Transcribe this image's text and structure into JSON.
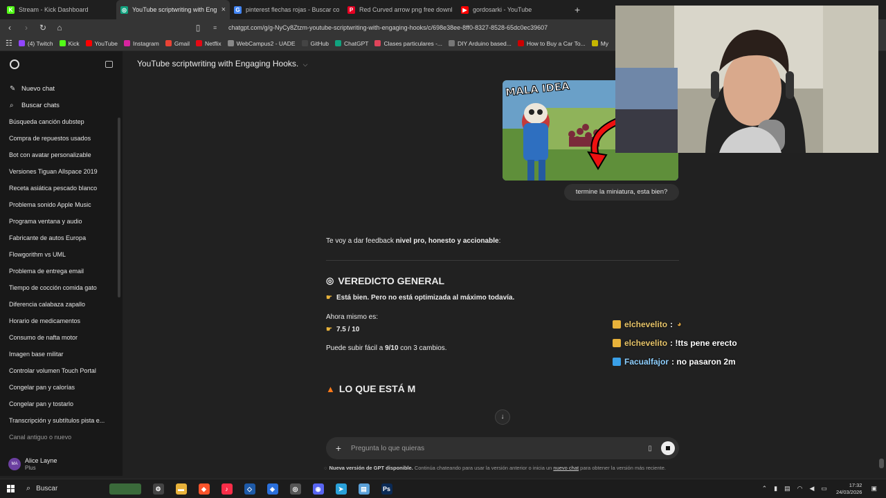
{
  "tabs": [
    {
      "label": "Stream - Kick Dashboard",
      "color": "#53fc18",
      "glyph": "K"
    },
    {
      "label": "YouTube scriptwriting with Eng",
      "color": "#10a37f",
      "glyph": "◎",
      "active": true
    },
    {
      "label": "pinterest flechas rojas - Buscar con G",
      "color": "#4285f4",
      "glyph": "G"
    },
    {
      "label": "Red Curved arrow png free downloa",
      "color": "#e60023",
      "glyph": "P"
    },
    {
      "label": "gordosarki - YouTube",
      "color": "#ff0000",
      "glyph": "▶"
    }
  ],
  "address": {
    "url": "chatgpt.com/g/g-NyCy8Ztzm-youtube-scriptwriting-with-engaging-hooks/c/698e38ee-8ff0-8327-8528-65dc0ec39607"
  },
  "bookmarks": [
    {
      "label": "(4) Twitch",
      "color": "#9146ff"
    },
    {
      "label": "Kick",
      "color": "#53fc18"
    },
    {
      "label": "YouTube",
      "color": "#ff0000"
    },
    {
      "label": "Instagram",
      "color": "#d6249f"
    },
    {
      "label": "Gmail",
      "color": "#ea4335"
    },
    {
      "label": "Netflix",
      "color": "#e50914"
    },
    {
      "label": "WebCampus2 - UADE",
      "color": "#888888"
    },
    {
      "label": "GitHub",
      "color": "#444444"
    },
    {
      "label": "ChatGPT",
      "color": "#10a37f"
    },
    {
      "label": "Clases particulares -...",
      "color": "#e0445a"
    },
    {
      "label": "DIY Arduino based...",
      "color": "#777777"
    },
    {
      "label": "How to Buy a Car To...",
      "color": "#cc0000"
    },
    {
      "label": "My",
      "color": "#c5b600"
    }
  ],
  "sidebar": {
    "new_chat": "Nuevo chat",
    "search_chats": "Buscar chats",
    "items": [
      "Búsqueda canción dubstep",
      "Compra de repuestos usados",
      "Bot con avatar personalizable",
      "Versiones Tiguan Allspace 2019",
      "Receta asiática pescado blanco",
      "Problema sonido Apple Music",
      "Programa ventana y audio",
      "Fabricante de autos Europa",
      "Flowgorithm vs UML",
      "Problema de entrega email",
      "Tiempo de cocción comida gato",
      "Diferencia calabaza zapallo",
      "Horario de medicamentos",
      "Consumo de nafta motor",
      "Imagen base militar",
      "Controlar volumen Touch Portal",
      "Congelar pan y calorías",
      "Congelar pan y tostarlo",
      "Transcripción y subtítulos pista e...",
      "Canal antiguo o nuevo"
    ],
    "user": {
      "initials": "MA",
      "name": "Alice Layne",
      "plan": "Plus"
    }
  },
  "conversation": {
    "title": "YouTube scriptwriting with Engaging Hooks.",
    "thumbnail_text": "MALA IDEA",
    "user_message": "termine la miniatura, esta bien?",
    "intro_pre": "Te voy a dar feedback ",
    "intro_bold": "nivel pro, honesto y accionable",
    "intro_post": ":",
    "verdict_heading": "VEREDICTO GENERAL",
    "verdict_line": "Está bien. Pero no está optimizada al máximo todavía.",
    "now_label": "Ahora mismo es:",
    "score": "7.5 / 10",
    "can_rise_pre": "Puede subir fácil a ",
    "can_rise_bold": "9/10",
    "can_rise_post": " con 3 cambios.",
    "next_heading": "LO QUE ESTÁ M"
  },
  "composer": {
    "placeholder": "Pregunta lo que quieras"
  },
  "notice": {
    "bold": "Nueva versión de GPT disponible.",
    "text": " Continúa chateando para usar la versión anterior o inicia un ",
    "link": "nuevo chat",
    "tail": " para obtener la versión más reciente."
  },
  "stream_chat": [
    {
      "user": "elchevelito",
      "message": " : ",
      "emote": true,
      "badge_color": "#e8b23a"
    },
    {
      "user": "elchevelito",
      "message": " : !tts pene erecto",
      "emote": false,
      "badge_color": "#e8b23a"
    },
    {
      "user": "Facualfajor",
      "message": " : no pasaron 2m",
      "emote": false,
      "badge_color": "#3aa0e8"
    }
  ],
  "taskbar": {
    "search": "Buscar",
    "time": "17:32",
    "date": "24/03/2026",
    "apps": [
      {
        "name": "settings",
        "color": "#444444",
        "glyph": "⚙"
      },
      {
        "name": "explorer",
        "color": "#e8b23a",
        "glyph": "▬"
      },
      {
        "name": "brave",
        "color": "#fb542b",
        "glyph": "◆"
      },
      {
        "name": "music",
        "color": "#fa2d48",
        "glyph": "♪"
      },
      {
        "name": "vscode",
        "color": "#1e5aa8",
        "glyph": "◇"
      },
      {
        "name": "sourcetree",
        "color": "#2a6fdb",
        "glyph": "◈"
      },
      {
        "name": "chrome",
        "color": "#555555",
        "glyph": "◎"
      },
      {
        "name": "discord",
        "color": "#5865f2",
        "glyph": "◉"
      },
      {
        "name": "telegram",
        "color": "#2aa1da",
        "glyph": "➤"
      },
      {
        "name": "notepad",
        "color": "#5aa0d8",
        "glyph": "▤"
      },
      {
        "name": "photoshop",
        "color": "#0b2a55",
        "glyph": "Ps"
      }
    ]
  }
}
